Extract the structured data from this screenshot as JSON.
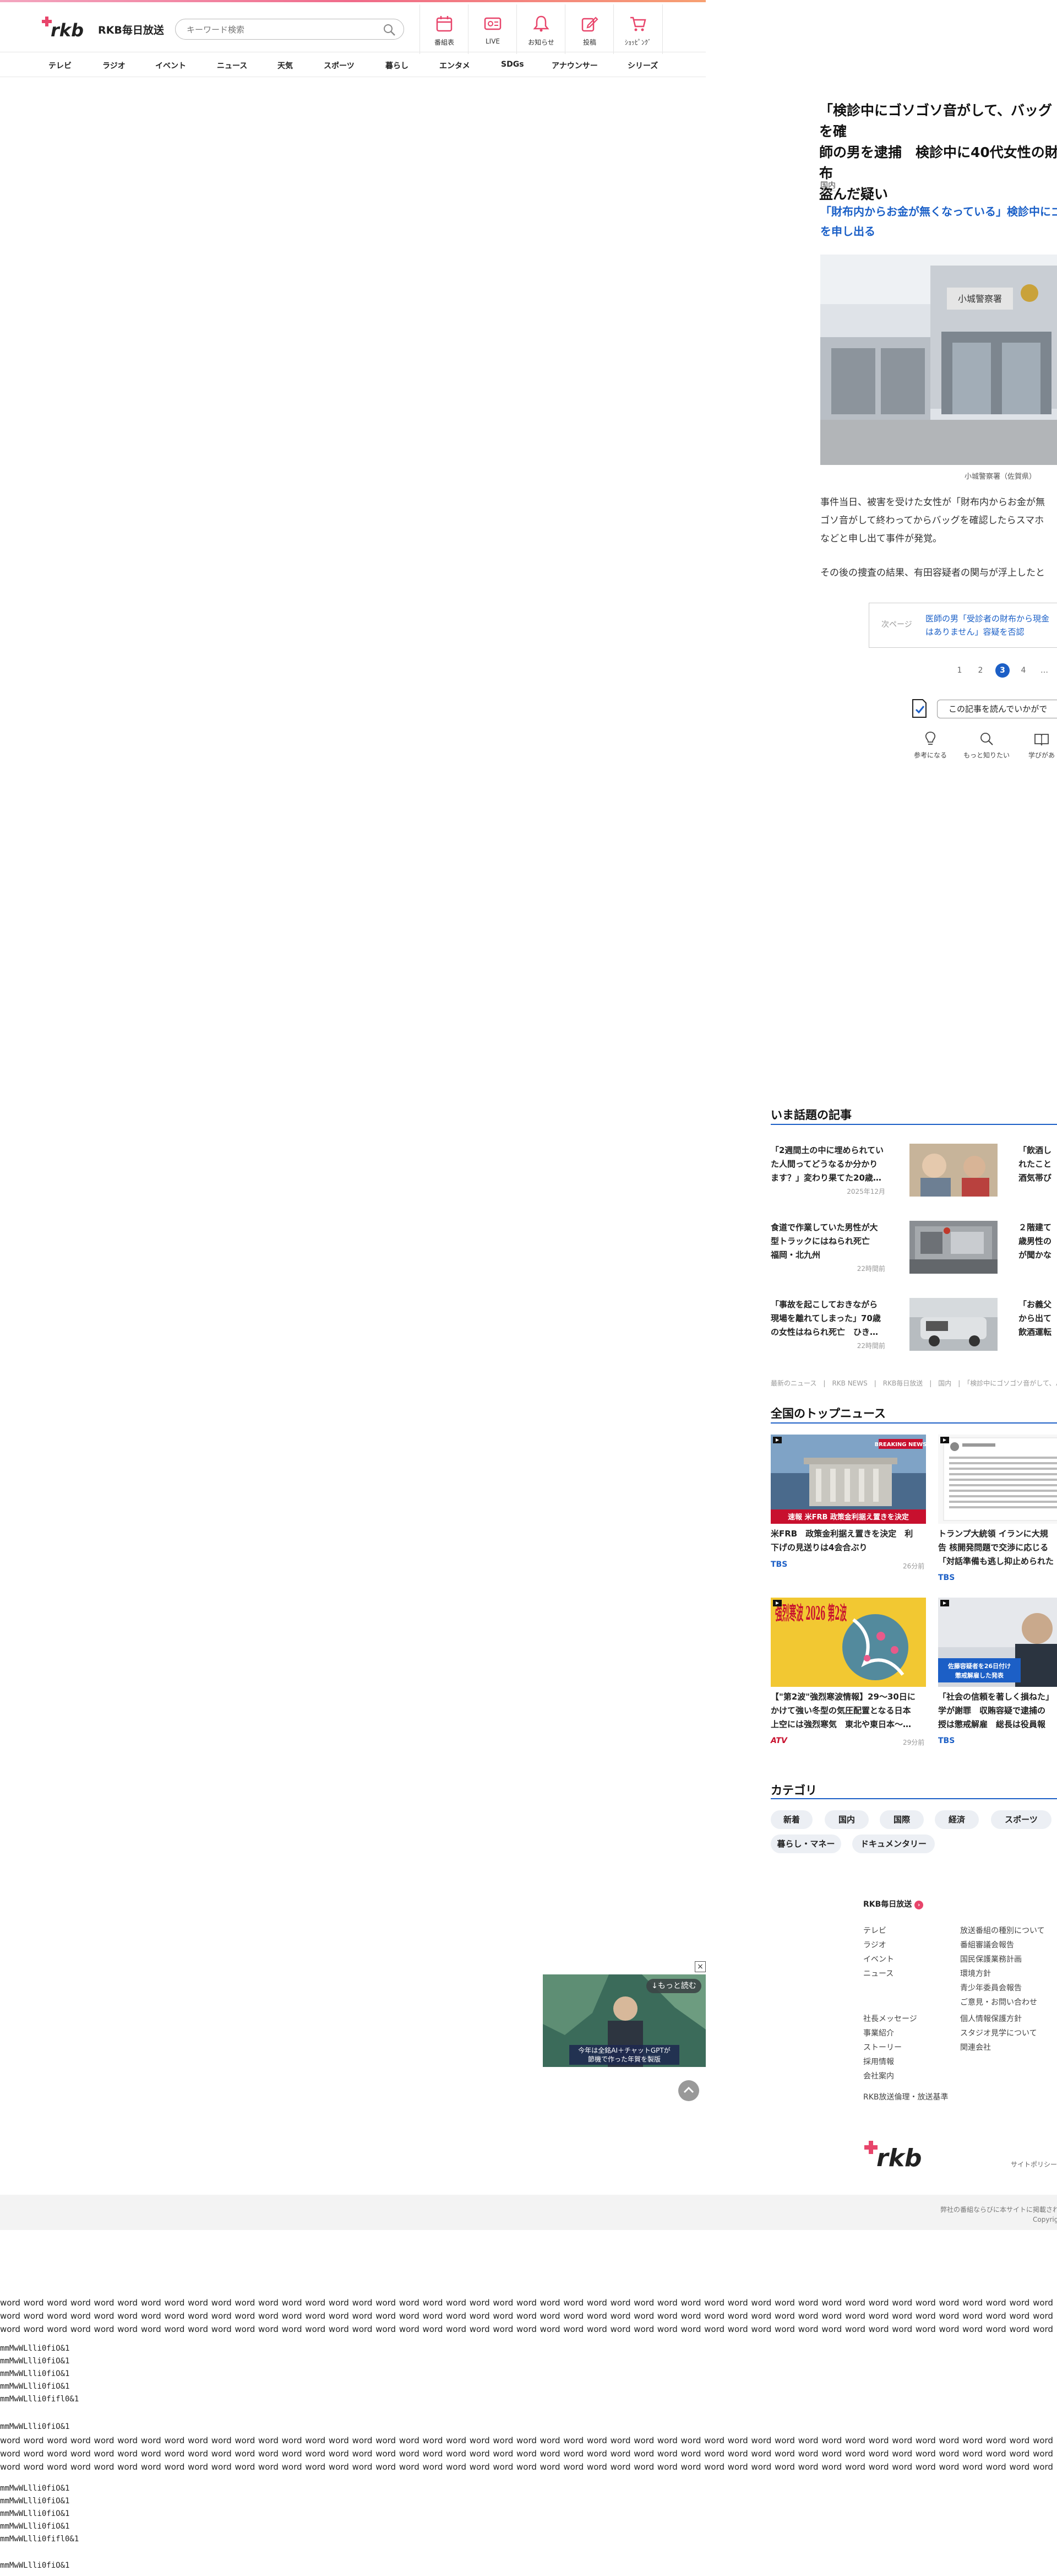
{
  "header": {
    "brand": "RKB毎日放送",
    "search_placeholder": "キーワード検索",
    "nav": [
      {
        "label": "番組表",
        "icon": "calendar-icon"
      },
      {
        "label": "LIVE",
        "icon": "live-icon"
      },
      {
        "label": "お知らせ",
        "icon": "bell-icon"
      },
      {
        "label": "投稿",
        "icon": "post-icon"
      },
      {
        "label": "ｼｮｯﾋﾟﾝｸﾞ",
        "icon": "cart-icon"
      }
    ],
    "categories": [
      "テレビ",
      "ラジオ",
      "イベント",
      "ニュース",
      "天気",
      "スポーツ",
      "暮らし",
      "エンタメ",
      "SDGs",
      "アナウンサー",
      "シリーズ"
    ]
  },
  "article": {
    "title": "「検診中にゴソゴソ音がして、バッグを確\n師の男を逮捕　検診中に40代女性の財布\n盗んだ疑い",
    "section": "国内",
    "lead": "「財布内からお金が無くなっている」検診中にゴ\nを申し出る",
    "photo_caption": "小城警察署（佐賀県）",
    "para1": "事件当日、被害を受けた女性が「財布内からお金が無\nゴソ音がして終わってからバッグを確認したらスマホ\nなどと申し出て事件が発覚。",
    "para2": "その後の捜査の結果、有田容疑者の関与が浮上したと",
    "related_page": "次ページ",
    "related_link": "医師の男「受診者の財布から現金\nはありません」容疑を否認",
    "pages": [
      "1",
      "2",
      "3",
      "4",
      "…"
    ],
    "active_page": "3",
    "survey_label": "この記事を読んでいかがで",
    "reactions": [
      "参考になる",
      "もっと知りたい",
      "学びがあ"
    ]
  },
  "trending": {
    "title": "いま話題の記事",
    "items": [
      {
        "text": "「2週間土の中に埋められてい\nた人間ってどうなるか分かり\nます？」変わり果てた20歳…",
        "date": "2025年12月"
      },
      {
        "text": "食道で作業していた男性が大\n型トラックにはねられ死亡\n福岡・北九州",
        "date": "22時間前"
      },
      {
        "text": "「事故を起こしておきながら\n現場を離れてしまった」70歳\nの女性はねられ死亡　ひき…",
        "date": "22時間前"
      }
    ],
    "items_right": [
      {
        "text": "「飲酒し\nれたこと\n酒気帯び"
      },
      {
        "text": "２階建て\n歳男性の\nが聞かな"
      },
      {
        "text": "「お義父\nから出て\n飲酒運転"
      }
    ],
    "breadcrumb": "最新のニュース　|　RKB NEWS　|　RKB毎日放送　|　国内　|　「検診中にゴソゴソ音がして、バッグを確認"
  },
  "top_news": {
    "title": "全国のトップニュース",
    "cards": [
      {
        "text": "米FRB　政策金利据え置きを決定　利\n下げの見送りは4会合ぶり",
        "source": "TBS",
        "time": "26分前",
        "badge": "BREAKING NEWS",
        "banner": "速報 米FRB 政策金利据え置きを決定"
      },
      {
        "text": "トランプ大統領 イランに大規\n告 核開発問題で交渉に応じる\n「対話準備も逃し抑止められた",
        "source": "TBS",
        "time": ""
      },
      {
        "text": "【\"第2波\"強烈寒波情報】29～30日に\nかけて強い冬型の気圧配置となる日本\n上空には強烈寒気　東北や東日本～…",
        "source": "ATV",
        "time": "29分前",
        "banner": "強烈寒波 2026 第2波"
      },
      {
        "text": "「社会の信頼を著しく損ねた」\n学が謝罪　収賄容疑で逮捕の\n授は懲戒解雇　総長は役員報",
        "source": "TBS",
        "time": "",
        "banner": "佐藤容疑者を26日付け\n懲戒解雇した発表"
      }
    ]
  },
  "categories": {
    "title": "カテゴリ",
    "chips": [
      "新着",
      "国内",
      "国際",
      "経済",
      "スポーツ",
      "暮らし・マネー",
      "ドキュメンタリー"
    ]
  },
  "footer": {
    "heading": "RKB毎日放送",
    "col1": [
      "テレビ",
      "ラジオ",
      "イベント",
      "ニュース"
    ],
    "col1b": [
      "社長メッセージ",
      "事業紹介",
      "ストーリー",
      "採用情報",
      "会社案内"
    ],
    "col2": [
      "放送番組の種別について",
      "番組審議会報告",
      "国民保護業務計画",
      "環境方針",
      "青少年委員会報告",
      "ご意見・お問い合わせ",
      "個人情報保護方針",
      "スタジオ見学について",
      "関連会社"
    ],
    "standards": "RKB放送倫理・放送基準",
    "site_policy": "サイトポリシー",
    "note": "弊社の番組ならびに本サイトに掲載されている",
    "copyright": "Copyright"
  },
  "ad": {
    "more": "↓もっと読む",
    "caption": "今年は全銘AI＋チャットGPTが\n節機で作った年賀を製版"
  },
  "filler": {
    "word_line": "word word word word word word word word word word word word word word word word word word word word word word word word word word word word word word word word word word word word word word word word word word word word word word word word word word word word word word word word word word word word word word word word word word word word word word word word word word word word word word word word word word word word word word word word word word word word word word word word word word word word word word word word word word word word word word word word word word word word word word word word word word word word word word word word word word word word word word word word word word word word word word word word word word word word word word word word word word word word word word word word word word word word word word word word word word word word word word word word word word",
    "mono_lines": [
      "mmMwWLlli0fiO&1",
      "mmMwWLlli0fiO&1",
      "mmMwWLlli0fiO&1",
      "mmMwWLlli0fiO&1",
      "mmMwWLlli0fifl0&1"
    ]
  }
}
